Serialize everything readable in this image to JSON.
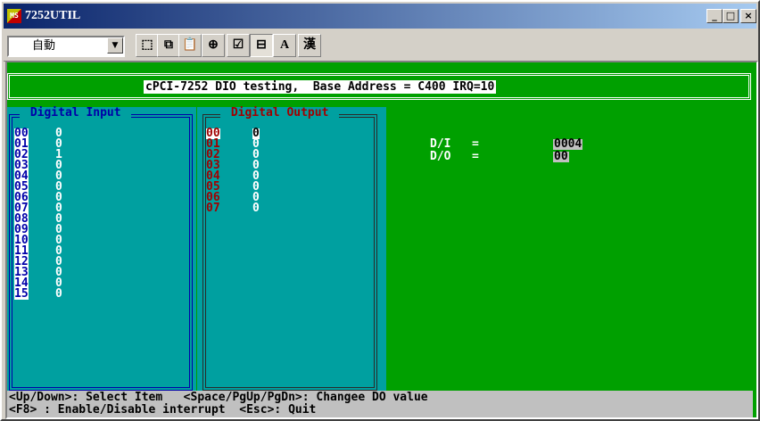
{
  "window": {
    "title": "7252UTIL",
    "icon_text": "MS",
    "minimize": "_",
    "maximize": "□",
    "close": "×"
  },
  "toolbar": {
    "font_combo": "自動",
    "combo_arrow": "▼",
    "buttons": [
      {
        "name": "mark-icon",
        "glyph": "⬚"
      },
      {
        "name": "copy-icon",
        "glyph": "⧉"
      },
      {
        "name": "paste-icon",
        "glyph": "📋"
      },
      {
        "name": "fullscreen-icon",
        "glyph": "⊕"
      },
      {
        "name": "properties-icon",
        "glyph": "☑"
      },
      {
        "name": "background-icon",
        "glyph": "⊟"
      },
      {
        "name": "font-icon",
        "glyph": "A"
      },
      {
        "name": "chinese-input-icon",
        "glyph": "漢"
      }
    ]
  },
  "console": {
    "header": "cPCI-7252 DIO testing,  Base Address = C400 IRQ=10",
    "input_title": " Digital Input ",
    "output_title": " Digital Output ",
    "inputs": [
      {
        "id": "00",
        "v": "0"
      },
      {
        "id": "01",
        "v": "0"
      },
      {
        "id": "02",
        "v": "1"
      },
      {
        "id": "03",
        "v": "0"
      },
      {
        "id": "04",
        "v": "0"
      },
      {
        "id": "05",
        "v": "0"
      },
      {
        "id": "06",
        "v": "0"
      },
      {
        "id": "07",
        "v": "0"
      },
      {
        "id": "08",
        "v": "0"
      },
      {
        "id": "09",
        "v": "0"
      },
      {
        "id": "10",
        "v": "0"
      },
      {
        "id": "11",
        "v": "0"
      },
      {
        "id": "12",
        "v": "0"
      },
      {
        "id": "13",
        "v": "0"
      },
      {
        "id": "14",
        "v": "0"
      },
      {
        "id": "15",
        "v": "0"
      }
    ],
    "outputs": [
      {
        "id": "00",
        "v": "0"
      },
      {
        "id": "01",
        "v": "0"
      },
      {
        "id": "02",
        "v": "0"
      },
      {
        "id": "03",
        "v": "0"
      },
      {
        "id": "04",
        "v": "0"
      },
      {
        "id": "05",
        "v": "0"
      },
      {
        "id": "06",
        "v": "0"
      },
      {
        "id": "07",
        "v": "0"
      }
    ],
    "di_label": "D/I   =",
    "di_value": "0004",
    "do_label": "D/O   =",
    "do_value": "00",
    "status1": "<Up/Down>: Select Item   <Space/PgUp/PgDn>: Changee DO value",
    "status2": "<F8> : Enable/Disable interrupt  <Esc>: Quit"
  }
}
